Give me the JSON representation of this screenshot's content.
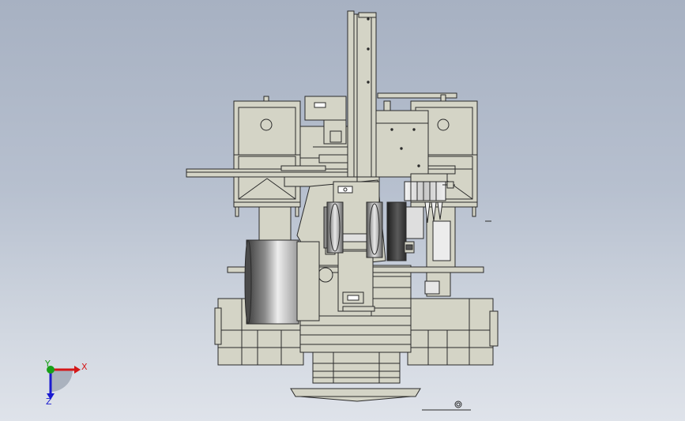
{
  "viewport": {
    "background_top": "#a7b1c2",
    "background_bottom": "#dfe3ea"
  },
  "model": {
    "body_color": "#d4d4c6",
    "shadow_color": "#bcbcae",
    "line_color": "#2a2a2a",
    "dark_color": "#3a3a3a"
  },
  "triad": {
    "x_label": "X",
    "y_label": "Y",
    "z_label": "Z",
    "x_color": "#d41818",
    "y_color": "#18a018",
    "z_color": "#1a1ad0"
  }
}
